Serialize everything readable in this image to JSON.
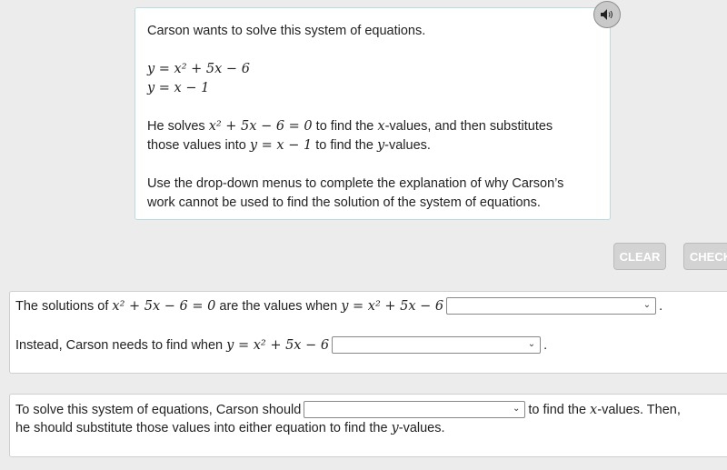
{
  "prompt": {
    "intro": "Carson wants to solve this system of equations.",
    "eq1": "y = x² + 5x − 6",
    "eq2": "y = x − 1",
    "p2_a": "He solves ",
    "p2_m1": "x² + 5x − 6 = 0",
    "p2_b": " to find the ",
    "p2_m2": "x",
    "p2_c": "-values, and then substitutes",
    "p2_d": "those values into ",
    "p2_m3": "y = x − 1",
    "p2_e": " to find the ",
    "p2_m4": "y",
    "p2_f": "-values.",
    "p3_line1": "Use the drop-down menus to complete the explanation of why Carson’s",
    "p3_line2": "work cannot be used to find the solution of the system of equations."
  },
  "speaker_icon": "speaker-icon",
  "buttons": {
    "clear": "CLEAR",
    "check": "CHECK"
  },
  "panel1": {
    "s1_a": "The solutions of ",
    "s1_m1": "x² + 5x − 6 = 0",
    "s1_b": " are the values when ",
    "s1_m2": "y = x² + 5x − 6",
    "s1_end": ".",
    "dropdown1": "",
    "s2_a": "Instead, Carson needs to find when ",
    "s2_m1": "y = x² + 5x − 6",
    "s2_end": ".",
    "dropdown2": ""
  },
  "panel2": {
    "a": "To solve this system of equations, Carson should ",
    "dropdown3": "",
    "b": " to find the ",
    "m1": "x",
    "c": "-values. Then,",
    "d": "he should substitute those values into either equation to find the ",
    "m2": "y",
    "e": "-values."
  }
}
